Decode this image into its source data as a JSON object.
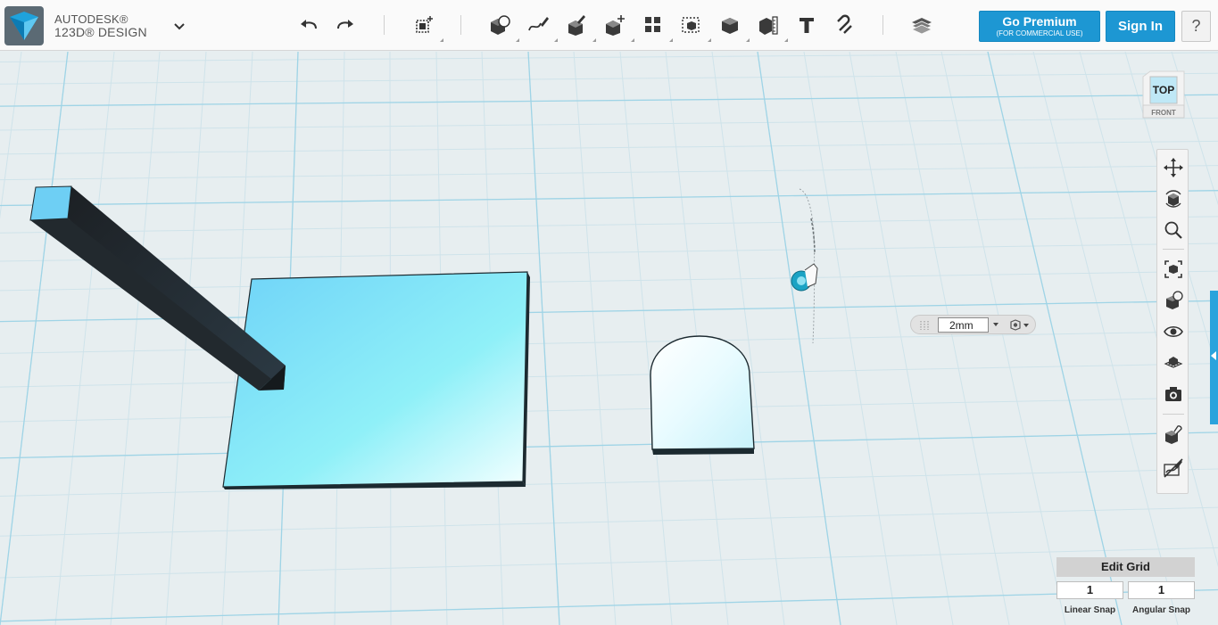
{
  "app": {
    "brand_line1": "AUTODESK®",
    "brand_line2": "123D® DESIGN"
  },
  "toolbar": {
    "icons": [
      "undo-icon",
      "redo-icon",
      "transform-icon",
      "primitives-icon",
      "sketch-icon",
      "construct-icon",
      "modify-icon",
      "pattern-icon",
      "grouping-icon",
      "combine-icon",
      "measure-icon",
      "text-icon",
      "snap-icon",
      "material-icon"
    ],
    "premium_label": "Go Premium",
    "premium_sublabel": "(FOR COMMERCIAL USE)",
    "signin_label": "Sign In",
    "help_label": "?"
  },
  "viewcube": {
    "face_label": "TOP"
  },
  "navbar": {
    "icons": [
      "pan-icon",
      "orbit-icon",
      "zoom-icon",
      "fit-icon",
      "view-mode-icon",
      "visibility-icon",
      "grid-icon",
      "camera-icon",
      "material-view-icon",
      "hide-sketch-icon"
    ]
  },
  "dimension_input": {
    "value": "2mm"
  },
  "grid": {
    "edit_label": "Edit Grid",
    "linear_snap_value": "1",
    "linear_snap_label": "Linear Snap",
    "angular_snap_value": "1",
    "angular_snap_label": "Angular Snap"
  },
  "colors": {
    "accent": "#1d97d3",
    "grid_major": "#9fd4e6",
    "grid_minor": "#c9e2ea",
    "background": "#e7eef0",
    "object_fill": "#7fdcf8"
  }
}
